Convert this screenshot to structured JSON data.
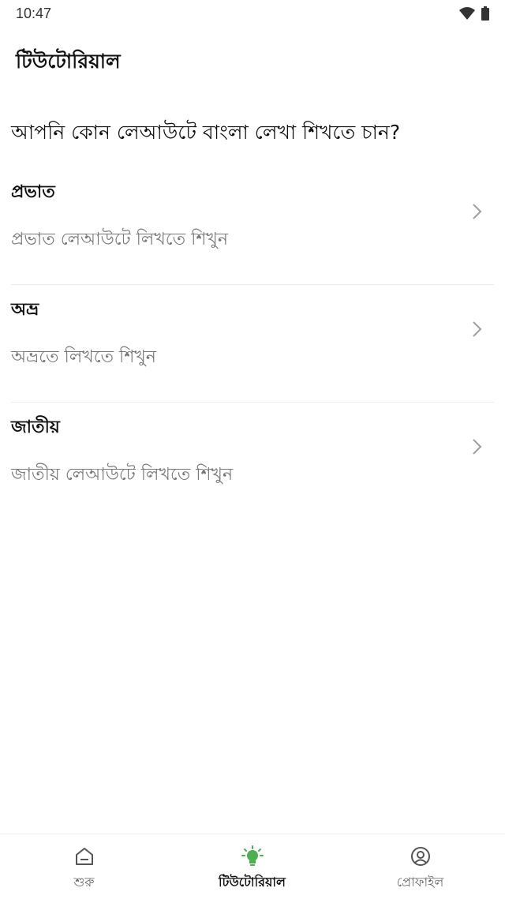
{
  "status": {
    "time": "10:47"
  },
  "page": {
    "title": "টিউটোরিয়াল",
    "question": "আপনি কোন লেআউটে বাংলা লেখা শিখতে চান?"
  },
  "layouts": [
    {
      "title": "প্রভাত",
      "subtitle": "প্রভাত লেআউটে লিখতে শিখুন"
    },
    {
      "title": "অভ্র",
      "subtitle": "অভ্রতে লিখতে শিখুন"
    },
    {
      "title": "জাতীয়",
      "subtitle": "জাতীয় লেআউটে লিখতে শিখুন"
    }
  ],
  "nav": {
    "home": "শুরু",
    "tutorial": "টিউটোরিয়াল",
    "profile": "প্রোফাইল",
    "active": "tutorial"
  },
  "colors": {
    "accent": "#4caf50",
    "icon_gray": "#555555",
    "chevron": "#9e9e9e"
  },
  "icons": {
    "home": "home-icon",
    "tutorial": "lightbulb-icon",
    "profile": "profile-icon",
    "chevron": "chevron-right-icon"
  }
}
